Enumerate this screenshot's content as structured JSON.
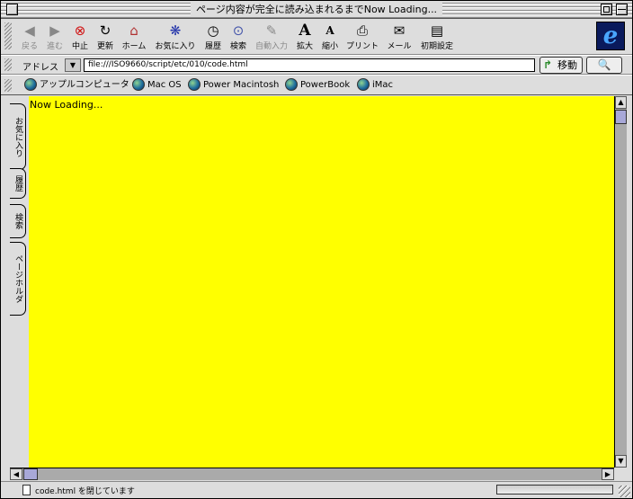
{
  "window": {
    "title": "ページ内容が完全に読み込まれるまでNow Loading..."
  },
  "toolbar": {
    "buttons": [
      {
        "label": "戻る",
        "icon": "back-arrow-icon",
        "glyph": "◀"
      },
      {
        "label": "進む",
        "icon": "forward-arrow-icon",
        "glyph": "▶"
      },
      {
        "label": "中止",
        "icon": "stop-icon",
        "glyph": "⊗"
      },
      {
        "label": "更新",
        "icon": "refresh-icon",
        "glyph": "↻"
      },
      {
        "label": "ホーム",
        "icon": "home-icon",
        "glyph": "⌂"
      },
      {
        "label": "お気に入り",
        "icon": "favorites-icon",
        "glyph": "❋"
      },
      {
        "label": "履歴",
        "icon": "history-icon",
        "glyph": "◷"
      },
      {
        "label": "検索",
        "icon": "search-icon",
        "glyph": "⊙"
      },
      {
        "label": "自動入力",
        "icon": "autofill-icon",
        "glyph": "✎"
      },
      {
        "label": "拡大",
        "icon": "enlarge-text-icon",
        "glyph": "A"
      },
      {
        "label": "縮小",
        "icon": "shrink-text-icon",
        "glyph": "A"
      },
      {
        "label": "プリント",
        "icon": "print-icon",
        "glyph": "⎙"
      },
      {
        "label": "メール",
        "icon": "mail-icon",
        "glyph": "✉"
      },
      {
        "label": "初期設定",
        "icon": "preferences-icon",
        "glyph": "▤"
      }
    ]
  },
  "address": {
    "label": "アドレス",
    "url": "file:///ISO9660/script/etc/010/code.html",
    "go_label": "移動",
    "options_glyph": "🔍"
  },
  "favorites": {
    "items": [
      {
        "label": "アップルコンピュータ"
      },
      {
        "label": "Mac OS"
      },
      {
        "label": "Power Macintosh"
      },
      {
        "label": "PowerBook"
      },
      {
        "label": "iMac"
      }
    ]
  },
  "sidetabs": [
    {
      "label": "お気に入り"
    },
    {
      "label": "履歴"
    },
    {
      "label": "検索"
    },
    {
      "label": "ページホルダ"
    }
  ],
  "content": {
    "message": "Now Loading...",
    "background": "#ffff00"
  },
  "status": {
    "text": "code.html を閉じています"
  }
}
